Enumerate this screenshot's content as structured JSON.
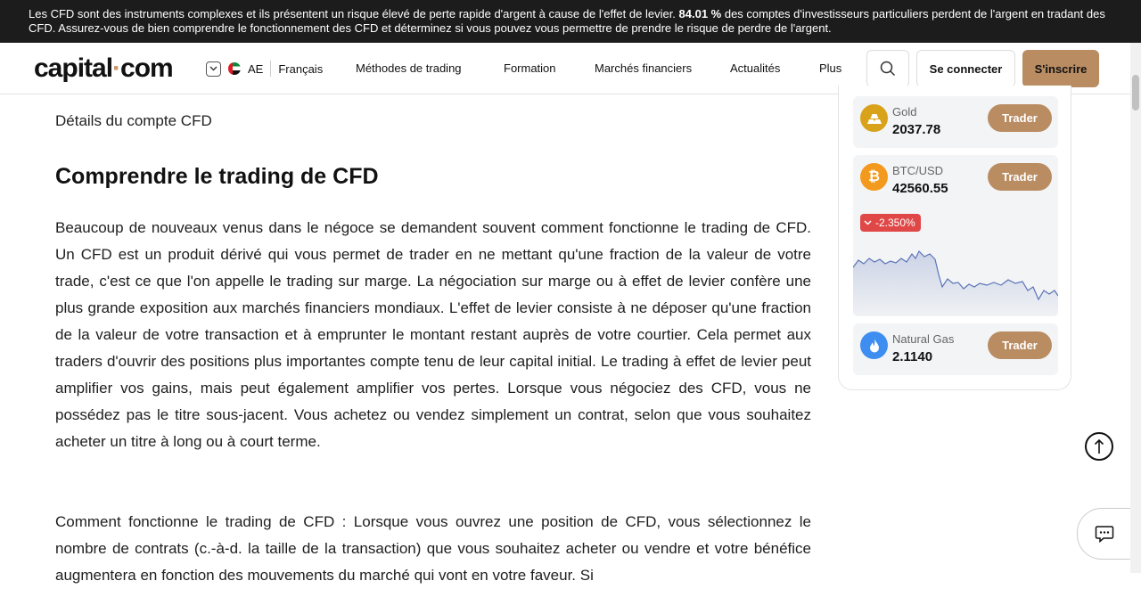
{
  "risk_banner": {
    "text_before": "Les CFD sont des instruments complexes et ils présentent un risque élevé de perte rapide d'argent à cause de l'effet de levier. ",
    "percent": "84.01 %",
    "text_after": " des comptes d'investisseurs particuliers perdent de l'argent en tradant des CFD. Assurez-vous de bien comprendre le fonctionnement des CFD et déterminez si vous pouvez vous permettre de prendre le risque de perdre de l'argent."
  },
  "header": {
    "logo_left": "capital",
    "logo_dot": "·",
    "logo_right": "com",
    "region_code": "AE",
    "language": "Français",
    "nav": [
      "Méthodes de trading",
      "Formation",
      "Marchés financiers",
      "Actualités",
      "Plus"
    ],
    "login_label": "Se connecter",
    "signup_label": "S'inscrire"
  },
  "article": {
    "subhead": "Détails du compte CFD",
    "heading": "Comprendre le trading de CFD",
    "paragraph1": "Beaucoup de nouveaux venus dans le négoce se demandent souvent comment fonctionne le trading de CFD. Un CFD est un produit dérivé qui vous permet de trader en ne mettant qu'une fraction de la valeur de votre trade, c'est ce que l'on appelle le trading sur marge. La négociation sur marge ou à effet de levier confère une plus grande exposition aux marchés financiers mondiaux. L'effet de levier consiste à ne déposer qu'une fraction de la valeur de votre transaction et à emprunter le montant restant auprès de votre courtier. Cela permet aux traders d'ouvrir des positions plus importantes compte tenu de leur capital initial. Le trading à effet de levier peut amplifier vos gains, mais peut également amplifier vos pertes. Lorsque vous négociez des CFD, vous ne possédez pas le titre sous-jacent. Vous achetez ou vendez simplement un contrat, selon que vous souhaitez acheter un titre à long ou à court terme.",
    "paragraph2": "Comment fonctionne le trading de CFD : Lorsque vous ouvrez une position de CFD, vous sélectionnez le nombre de contrats (c.-à-d. la taille de la transaction) que vous souhaitez acheter ou vendre et votre bénéfice augmentera en fonction des mouvements du marché qui vont en votre faveur. Si"
  },
  "markets": {
    "trade_label": "Trader",
    "assets": [
      {
        "name": "Gold",
        "price": "2037.78",
        "icon": "gold-bars-icon",
        "color": "#d9a21b"
      },
      {
        "name": "BTC/USD",
        "price": "42560.55",
        "icon": "bitcoin-icon",
        "color": "#f39a1e",
        "change": "-2.350%"
      },
      {
        "name": "Natural Gas",
        "price": "2.1140",
        "icon": "flame-icon",
        "color": "#3d8ef0"
      }
    ]
  },
  "colors": {
    "accent": "#b98c62",
    "banner_bg": "#1c1c1c",
    "negative": "#e04848"
  }
}
